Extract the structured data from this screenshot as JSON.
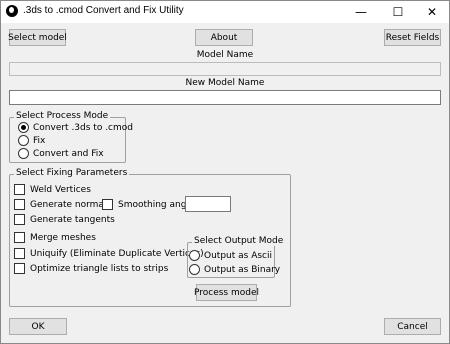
{
  "window": {
    "title": ".3ds to .cmod Convert and Fix Utility",
    "controls": {
      "minimize": "—",
      "maximize": "☐",
      "close": "✕"
    }
  },
  "top_buttons": {
    "select_model": "Select model",
    "about": "About",
    "reset_fields": "Reset Fields"
  },
  "model_name": {
    "label": "Model Name",
    "value": ""
  },
  "new_model_name": {
    "label": "New Model Name",
    "value": ""
  },
  "process_mode": {
    "title": "Select Process Mode",
    "options": [
      {
        "label": "Convert .3ds to .cmod",
        "selected": true
      },
      {
        "label": "Fix",
        "selected": false
      },
      {
        "label": "Convert and Fix",
        "selected": false
      }
    ]
  },
  "fixing": {
    "title": "Select Fixing Parameters",
    "weld_vertices": "Weld Vertices",
    "generate_normals": "Generate normals",
    "smoothing_angle": "Smoothing angle",
    "smoothing_value": "",
    "generate_tangents": "Generate tangents",
    "merge_meshes": "Merge meshes",
    "uniquify": "Uniquify (Eliminate Duplicate Vertices)",
    "optimize": "Optimize triangle lists to strips"
  },
  "output_mode": {
    "title": "Select Output Mode",
    "options": [
      {
        "label": "Output as Ascii",
        "selected": false
      },
      {
        "label": "Output as Binary",
        "selected": false
      }
    ]
  },
  "process_model": "Process model",
  "bottom_buttons": {
    "ok": "OK",
    "cancel": "Cancel"
  }
}
